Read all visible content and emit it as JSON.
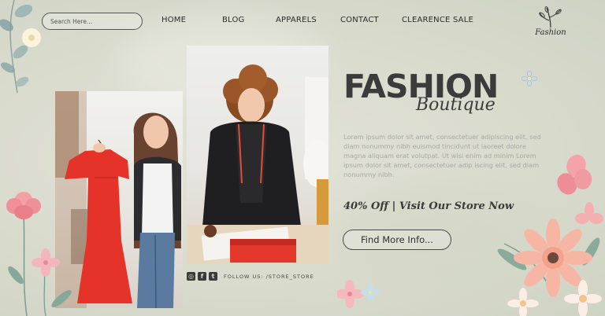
{
  "search": {
    "placeholder": "Search Here..."
  },
  "nav": {
    "items": [
      "HOME",
      "BLOG",
      "APPARELS",
      "CONTACT",
      "CLEARENCE SALE"
    ]
  },
  "logo": {
    "text": "Fashion"
  },
  "hero": {
    "title": "FASHION",
    "subtitle": "Boutique",
    "body": "Lorem ipsum dolor sit amet, consectetuer adipiscing elit, sed diam nonummy nibh euismod tincidunt ut laoreet dolore magna aliquam erat volutpat. Ut wisi enim ad minim Lorem ipsum dolor sit amet, consectetuer adip iscing elit, sed diam nonummy nibh.",
    "promo": "40% Off | Visit Our Store Now",
    "button_label": "Find More Info..."
  },
  "social": {
    "follow_text": "FOLLOW US: /STORE_STORE"
  },
  "colors": {
    "background": "#d9dbcd",
    "text": "#3b3b3b",
    "accent_pink": "#f2a7a0",
    "accent_red": "#e6332a"
  }
}
